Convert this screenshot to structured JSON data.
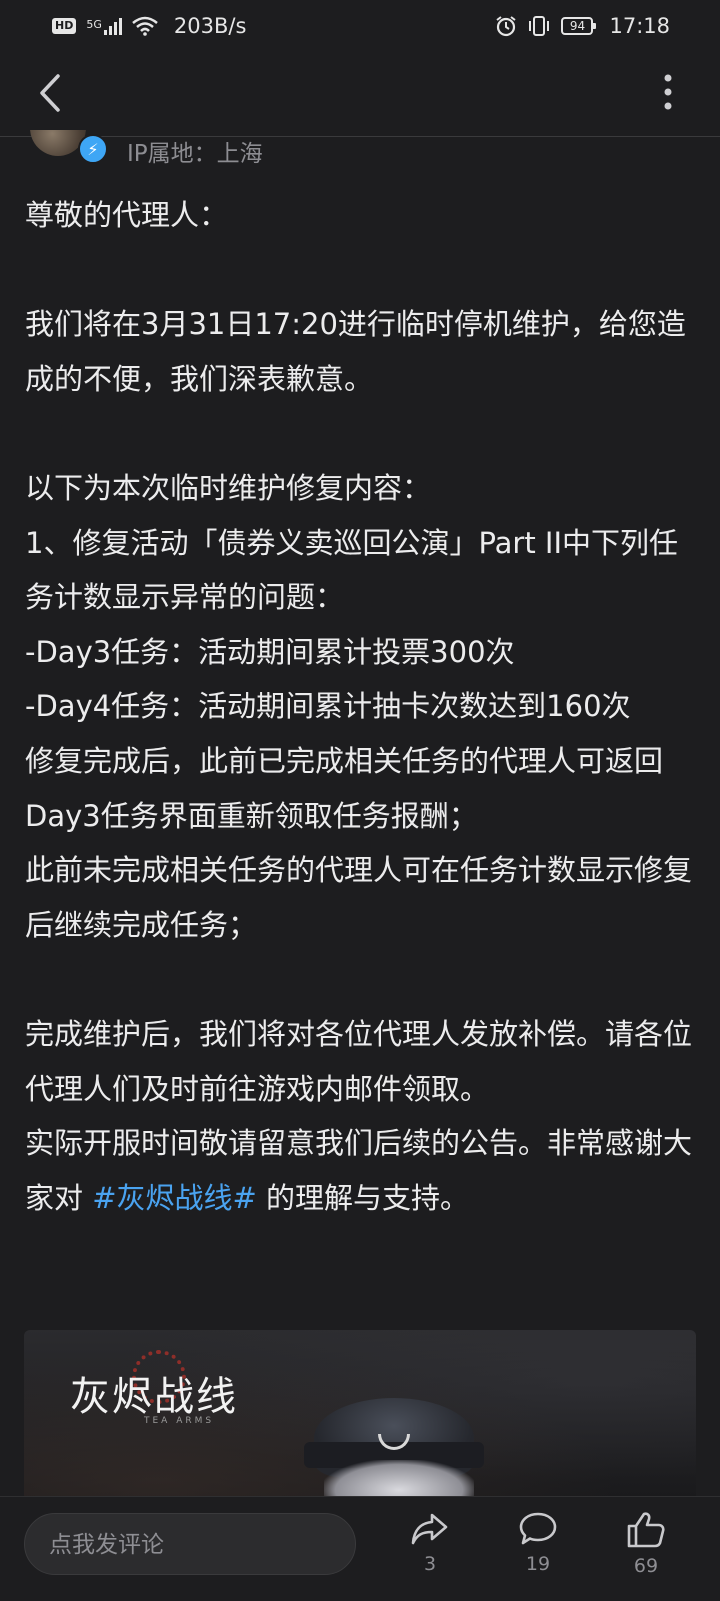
{
  "status_bar": {
    "hd": "HD",
    "network": "5G",
    "speed": "203B/s",
    "battery": "94",
    "time": "17:18"
  },
  "author": {
    "ip_location": "IP属地：上海"
  },
  "post": {
    "p1": "尊敬的代理人：",
    "p2": "我们将在3月31日17:20进行临时停机维护，给您造成的不便，我们深表歉意。",
    "p3": "以下为本次临时维护修复内容：",
    "p4": "1、修复活动「债券义卖巡回公演」Part II中下列任务计数显示异常的问题：",
    "p5": "-Day3任务：活动期间累计投票300次",
    "p6": "-Day4任务：活动期间累计抽卡次数达到160次",
    "p7": "修复完成后，此前已完成相关任务的代理人可返回Day3任务界面重新领取任务报酬；",
    "p8": "此前未完成相关任务的代理人可在任务计数显示修复后继续完成任务；",
    "p9": "完成维护后，我们将对各位代理人发放补偿。请各位代理人们及时前往游戏内邮件领取。",
    "p10_a": "实际开服时间敬请留意我们后续的公告。非常感谢大家对 ",
    "p10_hashtag": "#灰烬战线#",
    "p10_b": " 的理解与支持。"
  },
  "banner": {
    "logo": "灰烬战线",
    "sub": "TEA ARMS"
  },
  "bottom_bar": {
    "comment_placeholder": "点我发评论",
    "share_count": "3",
    "comment_count": "19",
    "like_count": "69"
  },
  "colors": {
    "background": "#1d1d1f",
    "hashtag": "#4aa3f0",
    "verified_badge": "#3ea6f5"
  },
  "icons": [
    "back-arrow-icon",
    "more-vertical-icon",
    "verified-icon",
    "share-icon",
    "comment-icon",
    "like-icon",
    "wifi-icon",
    "signal-icon",
    "alarm-icon",
    "vibrate-icon",
    "battery-icon"
  ]
}
